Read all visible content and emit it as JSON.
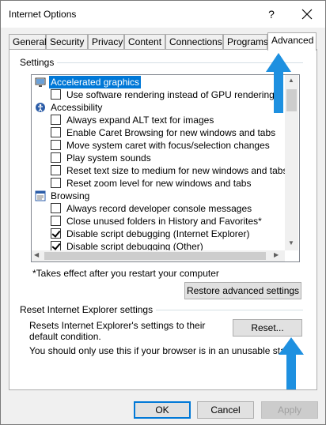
{
  "window": {
    "title": "Internet Options",
    "help_glyph": "?",
    "close_icon": "close-icon"
  },
  "tabs": [
    {
      "label": "General"
    },
    {
      "label": "Security"
    },
    {
      "label": "Privacy"
    },
    {
      "label": "Content"
    },
    {
      "label": "Connections"
    },
    {
      "label": "Programs"
    },
    {
      "label": "Advanced",
      "active": true
    }
  ],
  "settings": {
    "group_label": "Settings",
    "items": [
      {
        "type": "category",
        "label": "Accelerated graphics",
        "icon": "monitor-icon",
        "selected": true
      },
      {
        "type": "checkbox",
        "label": "Use software rendering instead of GPU rendering*",
        "checked": false
      },
      {
        "type": "category",
        "label": "Accessibility",
        "icon": "accessibility-icon"
      },
      {
        "type": "checkbox",
        "label": "Always expand ALT text for images",
        "checked": false
      },
      {
        "type": "checkbox",
        "label": "Enable Caret Browsing for new windows and tabs",
        "checked": false
      },
      {
        "type": "checkbox",
        "label": "Move system caret with focus/selection changes",
        "checked": false
      },
      {
        "type": "checkbox",
        "label": "Play system sounds",
        "checked": false
      },
      {
        "type": "checkbox",
        "label": "Reset text size to medium for new windows and tabs",
        "checked": false
      },
      {
        "type": "checkbox",
        "label": "Reset zoom level for new windows and tabs",
        "checked": false
      },
      {
        "type": "category",
        "label": "Browsing",
        "icon": "browsing-icon"
      },
      {
        "type": "checkbox",
        "label": "Always record developer console messages",
        "checked": false
      },
      {
        "type": "checkbox",
        "label": "Close unused folders in History and Favorites*",
        "checked": false
      },
      {
        "type": "checkbox",
        "label": "Disable script debugging (Internet Explorer)",
        "checked": true
      },
      {
        "type": "checkbox",
        "label": "Disable script debugging (Other)",
        "checked": true
      }
    ],
    "footnote": "*Takes effect after you restart your computer",
    "restore_button": "Restore advanced settings"
  },
  "reset": {
    "group_label": "Reset Internet Explorer settings",
    "description": "Resets Internet Explorer's settings to their default condition.",
    "reset_button": "Reset...",
    "warning": "You should only use this if your browser is in an unusable state."
  },
  "footer": {
    "ok": "OK",
    "cancel": "Cancel",
    "apply": "Apply"
  },
  "colors": {
    "selection": "#0078d7",
    "annotation_arrow": "#1e90e0"
  }
}
